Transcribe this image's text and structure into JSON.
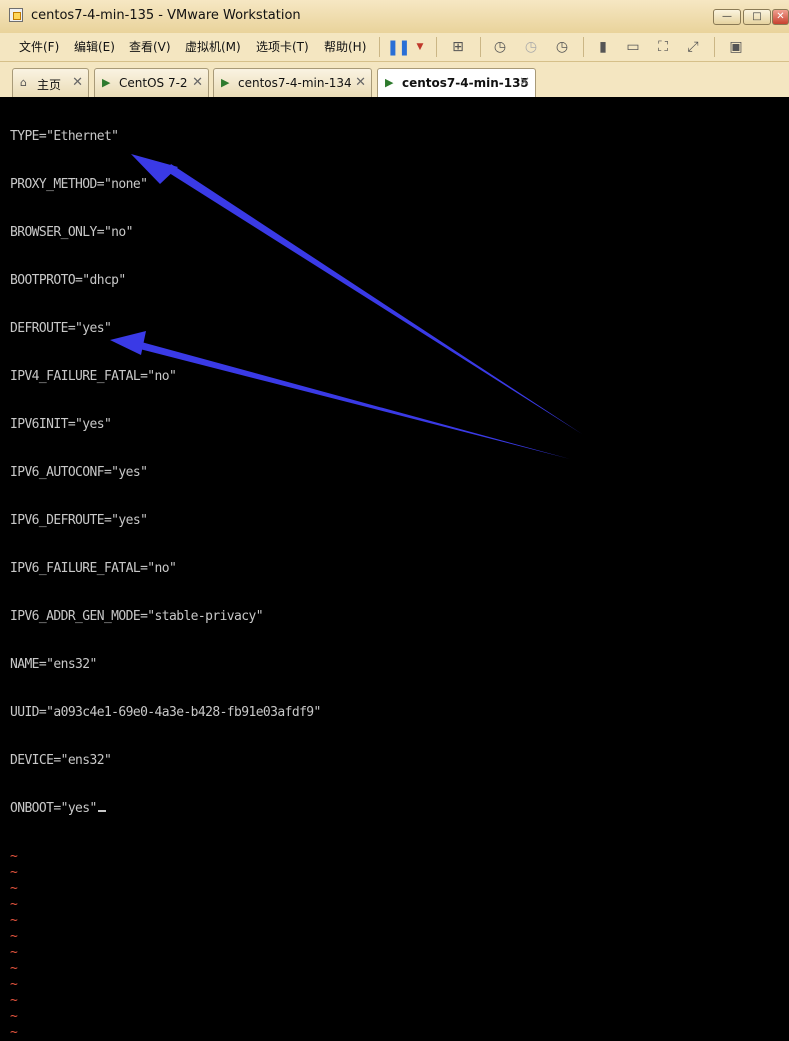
{
  "window": {
    "title": "centos7-4-min-135 - VMware Workstation",
    "controls": {
      "minimize": "—",
      "maximize": "□",
      "close": "✕"
    }
  },
  "menu": {
    "items": [
      "文件(F)",
      "编辑(E)",
      "查看(V)",
      "虚拟机(M)",
      "选项卡(T)",
      "帮助(H)"
    ]
  },
  "toolbar": {
    "icons": [
      "pause-icon",
      "dropdown-icon",
      "send-keys-icon",
      "snapshot-icon",
      "revert-snapshot-icon",
      "snapshot-manager-icon",
      "library-icon",
      "unity-icon",
      "fullscreen-icon",
      "autofit-icon",
      "console-view-icon"
    ]
  },
  "tabs": [
    {
      "label": "主页",
      "icon": "home-icon",
      "active": false
    },
    {
      "label": "CentOS 7-2",
      "icon": "vm-icon",
      "active": false
    },
    {
      "label": "centos7-4-min-134",
      "icon": "vm-icon",
      "active": false
    },
    {
      "label": "centos7-4-min-135",
      "icon": "vm-icon",
      "active": true
    }
  ],
  "tab_close": "✕",
  "console": {
    "lines": [
      "TYPE=\"Ethernet\"",
      "PROXY_METHOD=\"none\"",
      "BROWSER_ONLY=\"no\"",
      "BOOTPROTO=\"dhcp\"",
      "DEFROUTE=\"yes\"",
      "IPV4_FAILURE_FATAL=\"no\"",
      "IPV6INIT=\"yes\"",
      "IPV6_AUTOCONF=\"yes\"",
      "IPV6_DEFROUTE=\"yes\"",
      "IPV6_FAILURE_FATAL=\"no\"",
      "IPV6_ADDR_GEN_MODE=\"stable-privacy\"",
      "NAME=\"ens32\"",
      "UUID=\"a093c4e1-69e0-4a3e-b428-fb91e03afdf9\"",
      "DEVICE=\"ens32\"",
      "ONBOOT=\"yes\""
    ],
    "tilde_lines": 12,
    "tilde_char": "~"
  },
  "colors": {
    "titlebar": "#efdcab",
    "console_bg": "#000000",
    "console_text": "#c8c8c8",
    "tilde": "#e8553e",
    "annotation_arrow": "#3a3ae6"
  }
}
